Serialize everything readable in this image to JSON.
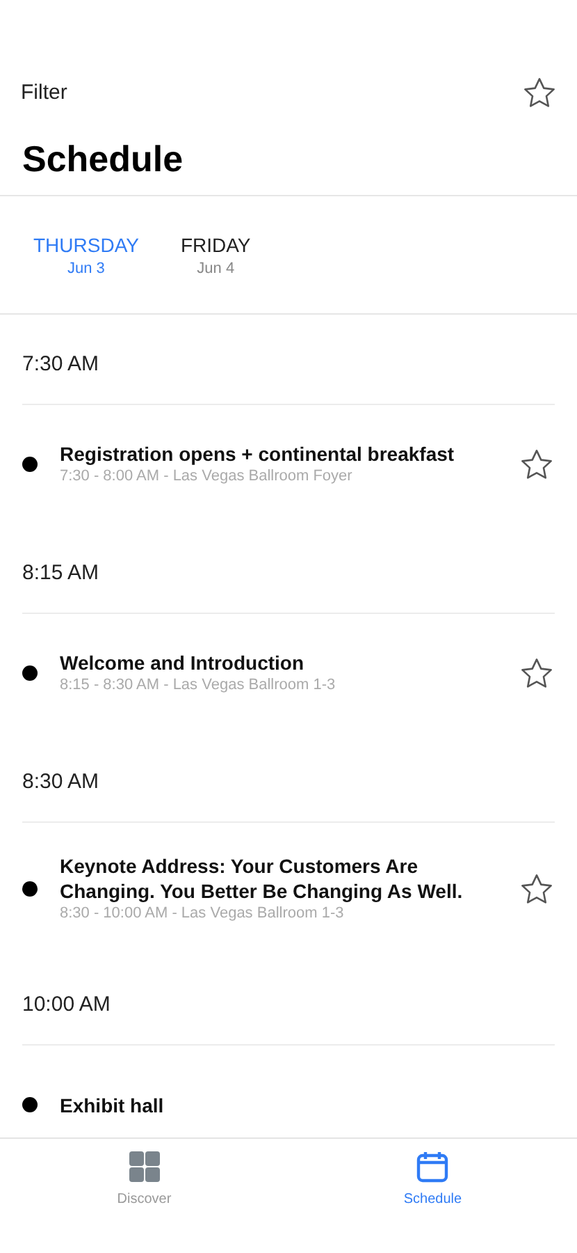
{
  "header": {
    "filter": "Filter",
    "title": "Schedule",
    "favorites_starred": false
  },
  "day_tabs": [
    {
      "day": "THURSDAY",
      "date": "Jun 3",
      "selected": true
    },
    {
      "day": "FRIDAY",
      "date": "Jun 4",
      "selected": false
    }
  ],
  "time_groups": [
    {
      "time": "7:30 AM",
      "events": [
        {
          "title": "Registration opens + continental breakfast",
          "details": "7:30 - 8:00 AM - Las Vegas Ballroom Foyer",
          "starred": false
        }
      ]
    },
    {
      "time": "8:15 AM",
      "events": [
        {
          "title": "Welcome and Introduction",
          "details": "8:15 - 8:30 AM - Las Vegas Ballroom 1-3",
          "starred": false
        }
      ]
    },
    {
      "time": "8:30 AM",
      "events": [
        {
          "title": "Keynote Address: Your Customers Are Changing. You Better Be Changing As Well.",
          "details": "8:30 - 10:00 AM - Las Vegas Ballroom 1-3",
          "starred": false
        }
      ]
    },
    {
      "time": "10:00 AM",
      "events": [
        {
          "title": "Exhibit hall"
        }
      ]
    }
  ],
  "tab_bar": [
    {
      "label": "Discover",
      "kind": "grid",
      "selected": false
    },
    {
      "label": "Schedule",
      "kind": "calendar",
      "selected": true
    }
  ]
}
